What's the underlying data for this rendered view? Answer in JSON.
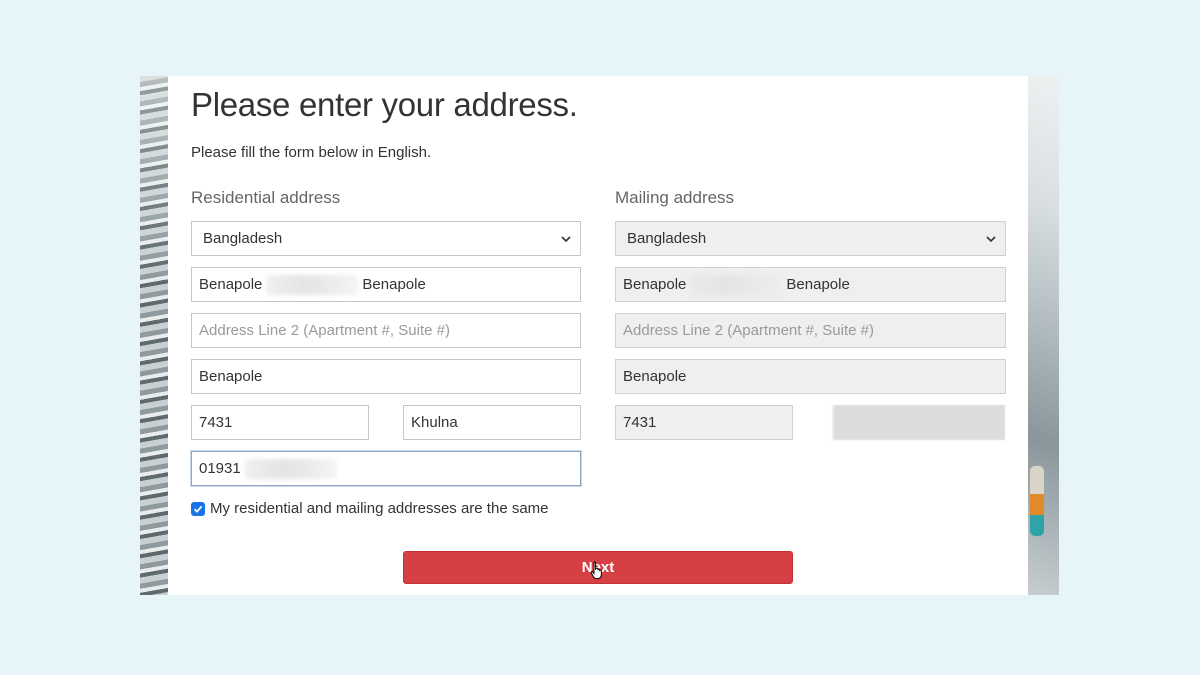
{
  "page": {
    "title": "Please enter your address.",
    "subtitle": "Please fill the form below in English."
  },
  "residential": {
    "label": "Residential address",
    "country": "Bangladesh",
    "address_line1_start": "Benapole",
    "address_line1_end": "Benapole",
    "address_line2_placeholder": "Address Line 2 (Apartment #, Suite #)",
    "city": "Benapole",
    "postal_code": "7431",
    "region": "Khulna",
    "phone_prefix": "01931"
  },
  "mailing": {
    "label": "Mailing address",
    "country": "Bangladesh",
    "address_line1_start": "Benapole",
    "address_line1_end": "Benapole",
    "address_line2_placeholder": "Address Line 2 (Apartment #, Suite #)",
    "city": "Benapole",
    "postal_code": "7431"
  },
  "same_address": {
    "label": "My residential and mailing addresses are the same",
    "checked": true
  },
  "actions": {
    "next_label": "Next"
  },
  "colors": {
    "primary_button": "#d64045",
    "checkbox_accent": "#1a73e8",
    "page_background": "#e6f5f8"
  },
  "icons": {
    "select_arrow": "chevron-down-icon",
    "checkbox": "checkmark-icon",
    "cursor": "hand-pointer-icon"
  }
}
